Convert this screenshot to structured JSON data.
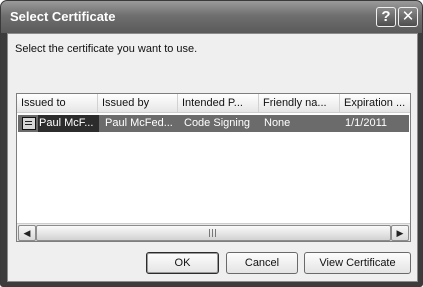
{
  "window": {
    "title": "Select Certificate",
    "help_glyph": "?",
    "close_glyph": "✕"
  },
  "prompt": "Select the certificate you want to use.",
  "list": {
    "columns": [
      "Issued to",
      "Issued by",
      "Intended P...",
      "Friendly na...",
      "Expiration ..."
    ],
    "rows": [
      {
        "issued_to": "Paul McF...",
        "issued_by": "Paul McFed...",
        "intended_purposes": "Code Signing",
        "friendly_name": "None",
        "expiration": "1/1/2011",
        "selected": true
      }
    ]
  },
  "scrollbar": {
    "left_glyph": "◀",
    "right_glyph": "▶"
  },
  "buttons": {
    "ok": "OK",
    "cancel": "Cancel",
    "view_certificate": "View Certificate"
  }
}
